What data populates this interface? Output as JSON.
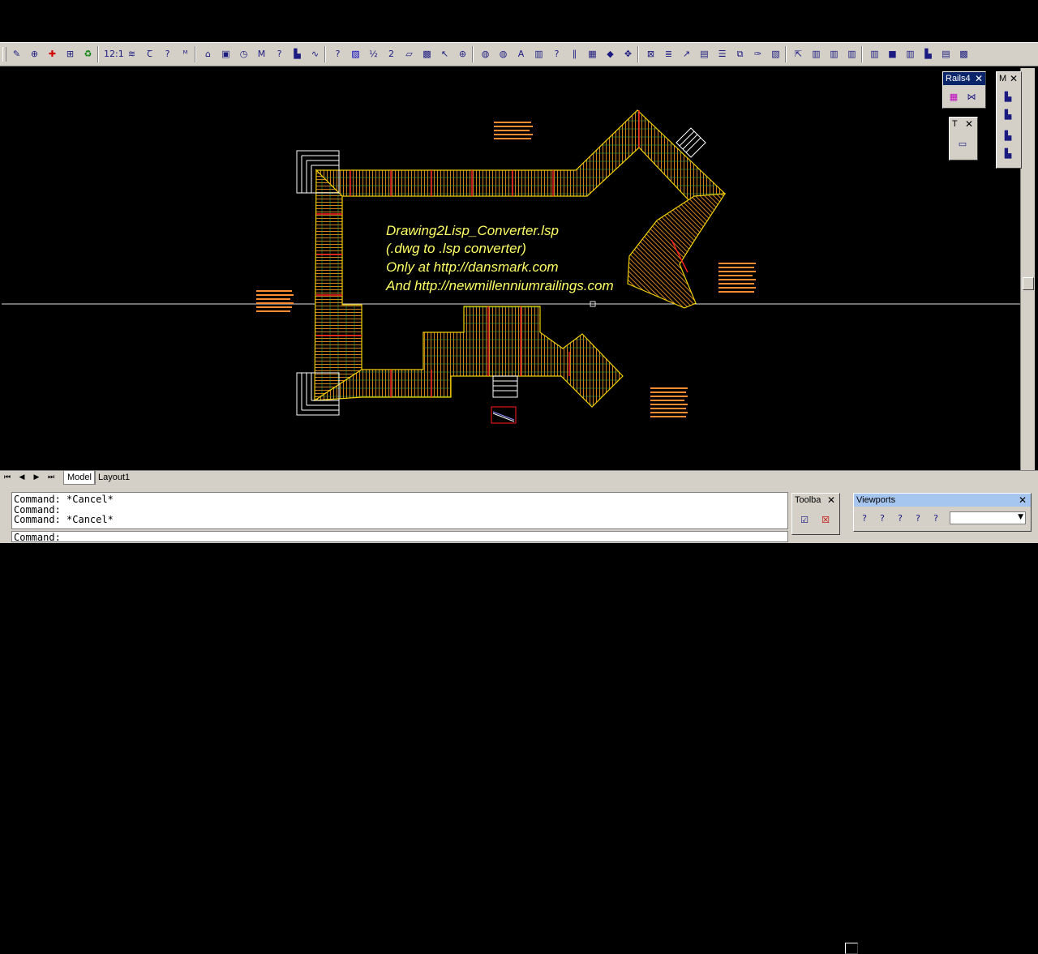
{
  "toolbar": {
    "buttons": [
      "pencil-icon",
      "target-icon",
      "cross-icon",
      "dimension-icon",
      "recycle-icon",
      "ratio-label",
      "layers-icon",
      "text-style-icon",
      "help-icon",
      "multitext-icon",
      "lock-icon",
      "block-icon",
      "clock-icon",
      "multiline-icon",
      "help-icon",
      "stairs-icon",
      "spline-icon",
      "help-icon",
      "hatch-icon",
      "fraction-label",
      "number-label",
      "folder-icon",
      "image-icon",
      "cursor-icon",
      "orbit-icon",
      "sphere-icon",
      "sphere-icon",
      "font-icon",
      "rail-icon",
      "help-icon",
      "post-icon",
      "grid-icon",
      "diamond-icon",
      "move-icon",
      "zoom-icon",
      "layer-icon",
      "arrow-icon",
      "plot-icon",
      "list-icon",
      "copy-icon",
      "pen-icon",
      "picture-icon",
      "open-icon",
      "fence-icon",
      "fence-icon",
      "rail-icon",
      "rail-icon",
      "stack-icon",
      "fence-icon",
      "stairs-icon",
      "plot-icon",
      "image-icon"
    ],
    "ratio_label": "12:1",
    "fraction_label": "½",
    "number_label": "2"
  },
  "drawing": {
    "annotations": {
      "line1": "Drawing2Lisp_Converter.lsp",
      "line2": "(.dwg to .lsp converter)",
      "line3": "Only at http://dansmark.com",
      "line4": "And http://newmillenniumrailings.com"
    },
    "colors": {
      "background": "#000000",
      "deck_outline": "#f0d000",
      "pickets": "#d08020",
      "posts": "#ff2020",
      "stairs": "#ffffff",
      "labels": "#ff8c30",
      "annotation": "#ffff66"
    }
  },
  "layout_tabs": {
    "model": "Model",
    "layout1": "Layout1"
  },
  "command": {
    "history": [
      "Command: *Cancel*",
      "Command:",
      "Command: *Cancel*"
    ],
    "prompt": "Command:"
  },
  "panels": {
    "rails": {
      "title": "Rails4"
    },
    "text": {
      "title": "T"
    },
    "m": {
      "title": "M"
    },
    "toolbar_small": {
      "title": "Toolba"
    },
    "viewports": {
      "title": "Viewports"
    }
  }
}
